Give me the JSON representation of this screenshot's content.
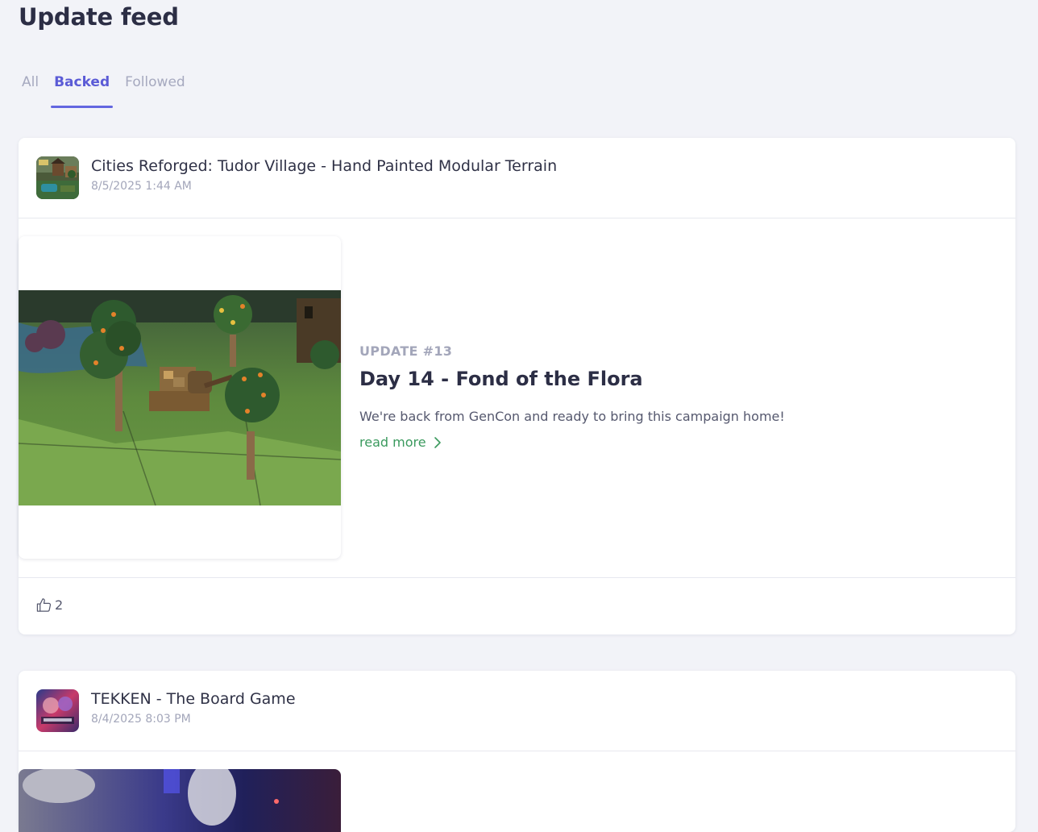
{
  "page": {
    "title": "Update feed"
  },
  "tabs": [
    {
      "label": "All",
      "active": false
    },
    {
      "label": "Backed",
      "active": true
    },
    {
      "label": "Followed",
      "active": false
    }
  ],
  "colors": {
    "accent": "#5b5bd6",
    "link": "#3b9a5e",
    "muted": "#a3a6ba",
    "background": "#f2f3f8"
  },
  "feed": [
    {
      "project_name": "Cities Reforged: Tudor Village - Hand Painted Modular Terrain",
      "date": "8/5/2025 1:44 AM",
      "update_number": "UPDATE #13",
      "update_title": "Day 14 - Fond of the Flora",
      "excerpt": "We're back from GenCon and ready to bring this campaign home!",
      "read_more": "read more",
      "likes": "2",
      "icons": {
        "like": "thumbs-up-icon",
        "read_more": "chevron-right-icon"
      }
    },
    {
      "project_name": "TEKKEN - The Board Game",
      "date": "8/4/2025 8:03 PM"
    }
  ]
}
